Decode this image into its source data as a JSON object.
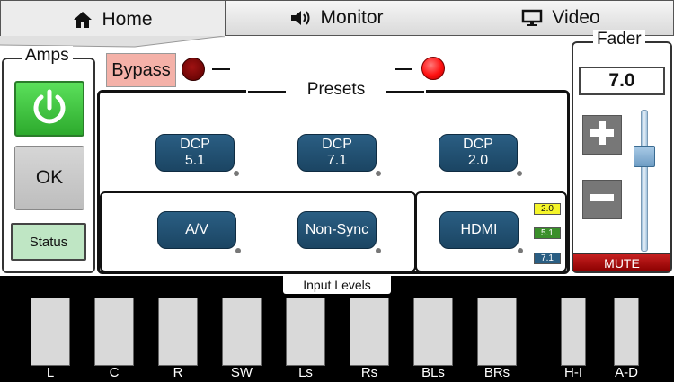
{
  "tabs": [
    {
      "label": "Home",
      "icon": "home-icon"
    },
    {
      "label": "Monitor",
      "icon": "speaker-icon"
    },
    {
      "label": "Video",
      "icon": "monitor-icon"
    }
  ],
  "amps": {
    "title": "Amps",
    "power_icon": "power-icon",
    "ok_label": "OK",
    "status_label": "Status"
  },
  "bypass": {
    "label": "Bypass",
    "left_led_color": "#8a0000",
    "right_led_color": "#ff2020"
  },
  "presets": {
    "title": "Presets",
    "top_buttons": [
      "DCP\n5.1",
      "DCP\n7.1",
      "DCP\n2.0"
    ],
    "bottom_left_buttons": [
      "A/V",
      "Non-Sync"
    ],
    "bottom_right_button": "HDMI",
    "formats": [
      {
        "label": "2.0",
        "color": "#f5f52a"
      },
      {
        "label": "5.1",
        "color": "#3a8f2a"
      },
      {
        "label": "7.1",
        "color": "#2a5e83"
      }
    ]
  },
  "fader": {
    "title": "Fader",
    "value": "7.0",
    "plus_icon": "plus-icon",
    "minus_icon": "minus-icon",
    "mute_label": "MUTE",
    "level": 0.7
  },
  "input_levels": {
    "title": "Input Levels",
    "channels": [
      "L",
      "C",
      "R",
      "SW",
      "Ls",
      "Rs",
      "BLs",
      "BRs",
      "H-I",
      "A-D"
    ]
  }
}
